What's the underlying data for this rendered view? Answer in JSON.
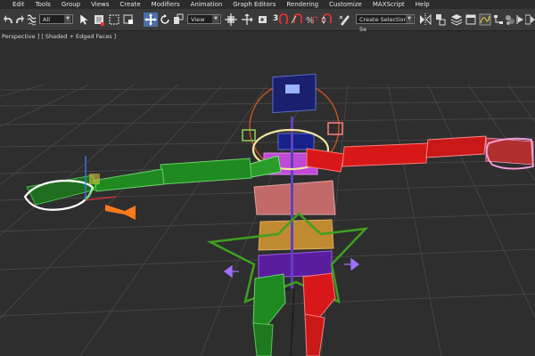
{
  "menu": [
    "Edit",
    "Tools",
    "Group",
    "Views",
    "Create",
    "Modifiers",
    "Animation",
    "Graph Editors",
    "Rendering",
    "Customize",
    "MAXScript",
    "Help"
  ],
  "toolbar": {
    "selection_filter": "All",
    "reference_coord": "View",
    "named_selection_placeholder": "Create Selection Se",
    "snap_label": "3",
    "icons": [
      "undo-icon",
      "redo-icon",
      "link-icon",
      "unlink-icon",
      "bind-spacewarp-icon",
      "selection-filter-dropdown",
      "select-object-icon",
      "select-by-name-icon",
      "rectangle-selection-icon",
      "window-crossing-icon",
      "select-move-icon",
      "select-rotate-icon",
      "select-scale-icon",
      "reference-coord-dropdown",
      "pivot-center-icon",
      "select-manipulate-icon",
      "keyboard-shortcut-icon",
      "snaps-toggle-icon",
      "angle-snap-icon",
      "percent-snap-icon",
      "spinner-snap-icon",
      "edit-named-selection-icon",
      "named-selection-dropdown",
      "mirror-icon",
      "align-icon",
      "layer-manager-icon",
      "graphite-ribbon-icon",
      "curve-editor-icon",
      "schematic-view-icon",
      "material-editor-icon",
      "render-setup-icon",
      "rendered-frame-icon",
      "render-production-icon"
    ]
  },
  "viewport": {
    "label": "Perspective ] [ Shaded + Edged Faces ]"
  },
  "colors": {
    "ui_bg": "#3a3a3a",
    "viewport_bg": "#2e2e2e",
    "grid": "#474747",
    "spine_blue": "#1c1c8a",
    "arm_green": "#1f8a1f",
    "arm_red": "#d81818",
    "pelvis_orange": "#c08a30",
    "chest_pink": "#c26a6a",
    "control_green": "#3fa020",
    "highlight_orange": "#ff7a1a"
  }
}
